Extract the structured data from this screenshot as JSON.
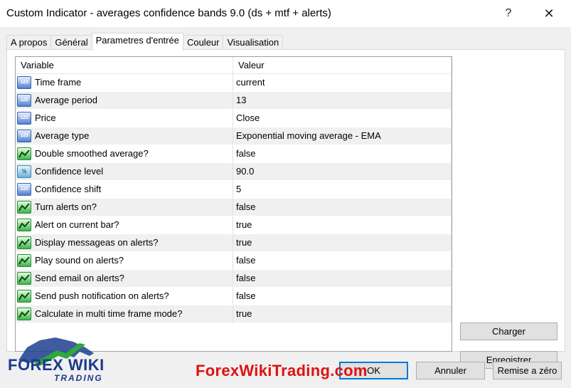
{
  "window": {
    "title": "Custom Indicator - averages confidence bands 9.0 (ds + mtf + alerts)",
    "help_glyph": "?",
    "close_glyph": "✕"
  },
  "tabs": [
    {
      "label": "A propos"
    },
    {
      "label": "Général"
    },
    {
      "label": "Parametres d'entrée",
      "active": true
    },
    {
      "label": "Couleur"
    },
    {
      "label": "Visualisation"
    }
  ],
  "grid": {
    "columns": [
      "Variable",
      "Valeur"
    ],
    "rows": [
      {
        "name": "Time frame",
        "value": "current",
        "icon": "number-type-icon"
      },
      {
        "name": "Average period",
        "value": "13",
        "icon": "number-type-icon"
      },
      {
        "name": "Price",
        "value": "Close",
        "icon": "number-type-icon"
      },
      {
        "name": "Average type",
        "value": "Exponential moving average - EMA",
        "icon": "number-type-icon"
      },
      {
        "name": "Double smoothed average?",
        "value": "false",
        "icon": "boolean-type-icon"
      },
      {
        "name": "Confidence level",
        "value": "90.0",
        "icon": "double-type-icon"
      },
      {
        "name": "Confidence shift",
        "value": "5",
        "icon": "number-type-icon"
      },
      {
        "name": "Turn alerts on?",
        "value": "false",
        "icon": "boolean-type-icon"
      },
      {
        "name": "Alert on current bar?",
        "value": "true",
        "icon": "boolean-type-icon"
      },
      {
        "name": "Display messageas on alerts?",
        "value": "true",
        "icon": "boolean-type-icon"
      },
      {
        "name": "Play sound on alerts?",
        "value": "false",
        "icon": "boolean-type-icon"
      },
      {
        "name": "Send email on alerts?",
        "value": "false",
        "icon": "boolean-type-icon"
      },
      {
        "name": "Send push notification on alerts?",
        "value": "false",
        "icon": "boolean-type-icon"
      },
      {
        "name": "Calculate in multi time frame mode?",
        "value": "true",
        "icon": "boolean-type-icon"
      }
    ]
  },
  "buttons": {
    "charger": "Charger",
    "enregistrer": "Enregistrer",
    "ok": "OK",
    "annuler": "Annuler",
    "reset": "Remise a zéro"
  },
  "watermark": {
    "logo_text_forex": "FOREX WIKI",
    "logo_text_trading": "TRADING",
    "site_text": "ForexWikiTrading.com",
    "site_color": "#e01010",
    "logo_color": "#1a3a8a"
  },
  "icon_glyphs": {
    "number-type-icon": "123",
    "double-type-icon": "½"
  },
  "colors": {
    "row_alt": "#f0f0f0",
    "ok_focus": "#0078d7",
    "client_bg": "#f0f0f0"
  }
}
